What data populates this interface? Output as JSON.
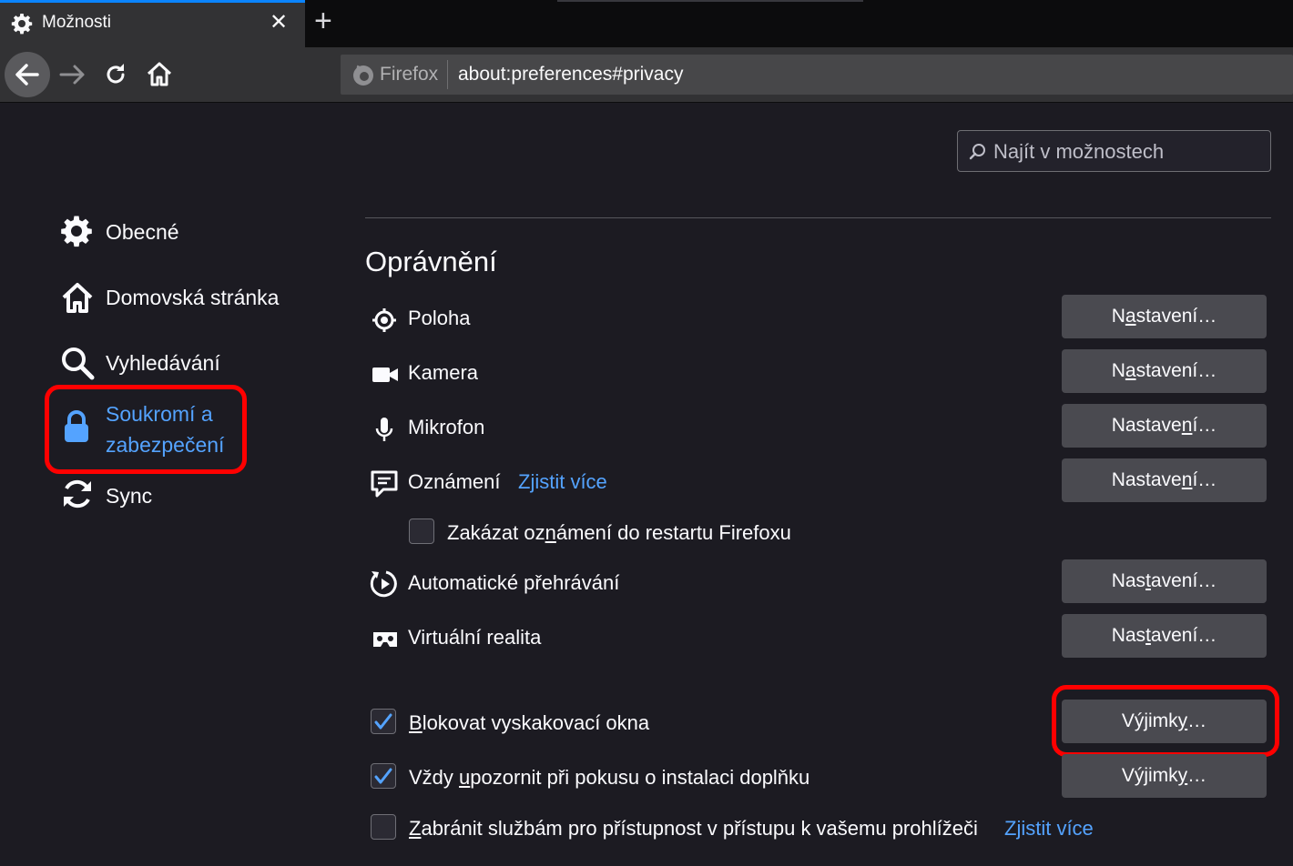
{
  "tab": {
    "title": "Možnosti",
    "close": "✕",
    "new_tab": "+"
  },
  "navbar": {
    "identity_label": "Firefox",
    "url": "about:preferences#privacy"
  },
  "search": {
    "placeholder": "Najít v možnostech"
  },
  "sidebar": {
    "items": [
      {
        "label": "Obecné",
        "icon": "gear-icon"
      },
      {
        "label": "Domovská stránka",
        "icon": "home-icon"
      },
      {
        "label": "Vyhledávání",
        "icon": "search-icon"
      },
      {
        "label_line1": "Soukromí a",
        "label_line2": "zabezpečení",
        "icon": "lock-icon",
        "selected": true
      },
      {
        "label": "Sync",
        "icon": "sync-icon"
      }
    ]
  },
  "section": {
    "title": "Oprávnění",
    "permissions": [
      {
        "label": "Poloha",
        "button_pre": "N",
        "button_key": "a",
        "button_post": "stavení…",
        "icon": "location-icon"
      },
      {
        "label": "Kamera",
        "button_pre": "N",
        "button_key": "a",
        "button_post": "stavení…",
        "icon": "camera-icon"
      },
      {
        "label": "Mikrofon",
        "button_pre": "Nastave",
        "button_key": "n",
        "button_post": "í…",
        "icon": "microphone-icon"
      },
      {
        "label": "Oznámení",
        "link": "Zjistit více",
        "button_pre": "Nastave",
        "button_key": "n",
        "button_post": "í…",
        "icon": "notification-icon"
      },
      {
        "label": "Automatické přehrávání",
        "button_pre": "Nas",
        "button_key": "t",
        "button_post": "avení…",
        "icon": "autoplay-icon"
      },
      {
        "label": "Virtuální realita",
        "button_pre": "Nas",
        "button_key": "t",
        "button_post": "avení…",
        "icon": "vr-icon"
      }
    ],
    "pause_notifications": {
      "pre": "Zakázat oz",
      "key": "n",
      "post": "ámení do restartu Firefoxu",
      "checked": false
    },
    "block_popups": {
      "pre": "",
      "key": "B",
      "post": "lokovat vyskakovací okna",
      "checked": true,
      "button_pre": "Výjimk",
      "button_key": "y",
      "button_post": "…"
    },
    "warn_addons": {
      "pre": "Vždy ",
      "key": "u",
      "post": "pozornit při pokusu o instalaci doplňku",
      "checked": true,
      "button_pre": "Výjimk",
      "button_key": "y",
      "button_post": "…"
    },
    "a11y": {
      "pre": "",
      "key": "Z",
      "post": "abránit službám pro přístupnost v přístupu k vašemu prohlížeči",
      "checked": false,
      "link": "Zjistit více"
    }
  },
  "colors": {
    "accent": "#0a84ff",
    "link": "#54a3ff",
    "highlight": "#ff0000",
    "background": "#1c1b22"
  }
}
